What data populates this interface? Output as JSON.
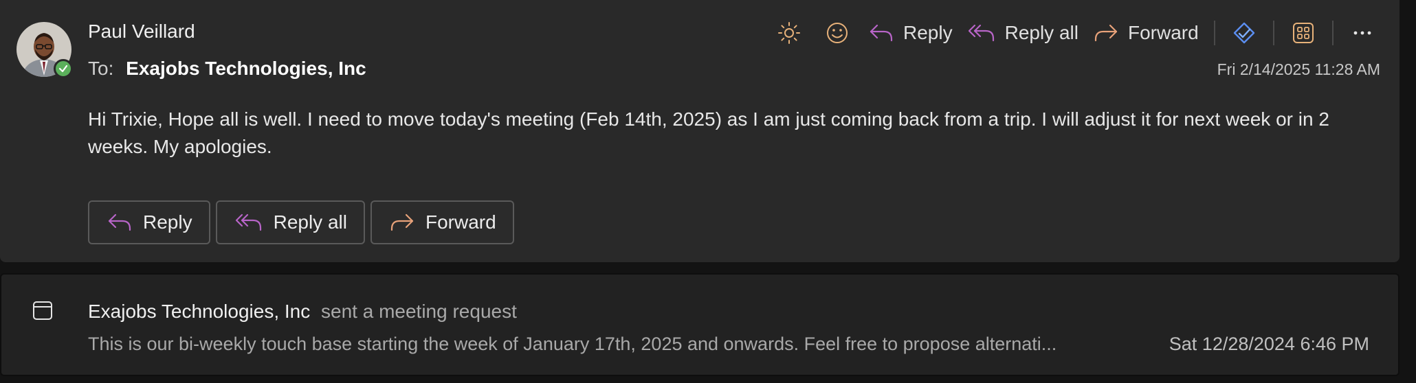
{
  "message": {
    "sender": "Paul Veillard",
    "to_label": "To:",
    "to_value": "Exajobs Technologies, Inc",
    "timestamp": "Fri 2/14/2025 11:28 AM",
    "body": "Hi Trixie, Hope all is well. I need to move today's meeting (Feb 14th, 2025) as I am just coming back from a trip. I will adjust it for next week or in 2 weeks. My apologies.",
    "presence": "available",
    "toolbar": {
      "icons": [
        "sun-icon",
        "emoji-icon",
        "viva-insights-icon",
        "apps-icon",
        "more-icon"
      ],
      "reply": "Reply",
      "reply_all": "Reply all",
      "forward": "Forward"
    },
    "quick_actions": {
      "reply": "Reply",
      "reply_all": "Reply all",
      "forward": "Forward"
    }
  },
  "second_item": {
    "icon": "calendar-icon",
    "organizer": "Exajobs Technologies, Inc",
    "action": "sent a meeting request",
    "preview": "This is our bi-weekly touch base starting the week of January 17th, 2025 and onwards. Feel free to propose alternati...",
    "date": "Sat 12/28/2024 6:46 PM"
  },
  "colors": {
    "reply_accent": "#b865c8",
    "forward_accent": "#e8a27a",
    "icon_accent": "#e8b27a",
    "presence_green": "#5bb05b",
    "card_bg": "#292929"
  }
}
